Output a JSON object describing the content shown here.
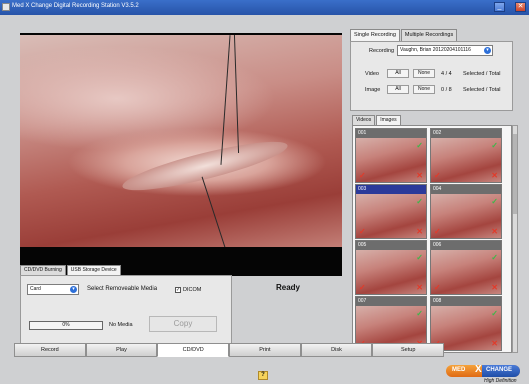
{
  "window": {
    "title": "Med X Change Digital Recording Station V3.5.2",
    "minimize_glyph": "_",
    "maximize_glyph": "□",
    "close_glyph": "✕"
  },
  "recording_panel": {
    "tabs": [
      "Single Recording",
      "Multiple Recordings"
    ],
    "recording_label": "Recording",
    "recording_value": "Vaughn, Brian 20120204101116",
    "video_label": "Video",
    "image_label": "Image",
    "all_label": "All",
    "none_label": "None",
    "video_count": "4 / 4",
    "image_count": "0 / 8",
    "selected_total_label": "Selected / Total"
  },
  "media_tabs": [
    "Videos",
    "Images"
  ],
  "thumbnails": [
    {
      "number": "001"
    },
    {
      "number": "002"
    },
    {
      "number": "003"
    },
    {
      "number": "004"
    },
    {
      "number": "005"
    },
    {
      "number": "006"
    },
    {
      "number": "007"
    },
    {
      "number": "008"
    }
  ],
  "burn_panel": {
    "tabs": [
      "CD/DVD Burning",
      "USB Storage Device"
    ],
    "device_value": "Card",
    "select_media_label": "Select Removeable Media",
    "dicom_label": "DICOM",
    "progress_value": "0%",
    "no_media_label": "No Media",
    "copy_label": "Copy"
  },
  "status_text": "Ready",
  "nav_buttons": [
    "Record",
    "Play",
    "CD/DVD",
    "Print",
    "Disk",
    "Setup"
  ],
  "help_glyph": "?",
  "logo": {
    "left": "MED",
    "x": "X",
    "right": "CHANGE",
    "tagline": "High Definition"
  },
  "colors": {
    "title_bar": "#2753a8",
    "selected_thumb": "#2b3a9a",
    "check_green": "#3db74a",
    "cross_red": "#e23a2a"
  },
  "icons": [
    "close-icon",
    "minimize-icon",
    "maximize-icon",
    "dropdown-icon",
    "checkmark-icon",
    "cross-icon",
    "help-icon"
  ]
}
